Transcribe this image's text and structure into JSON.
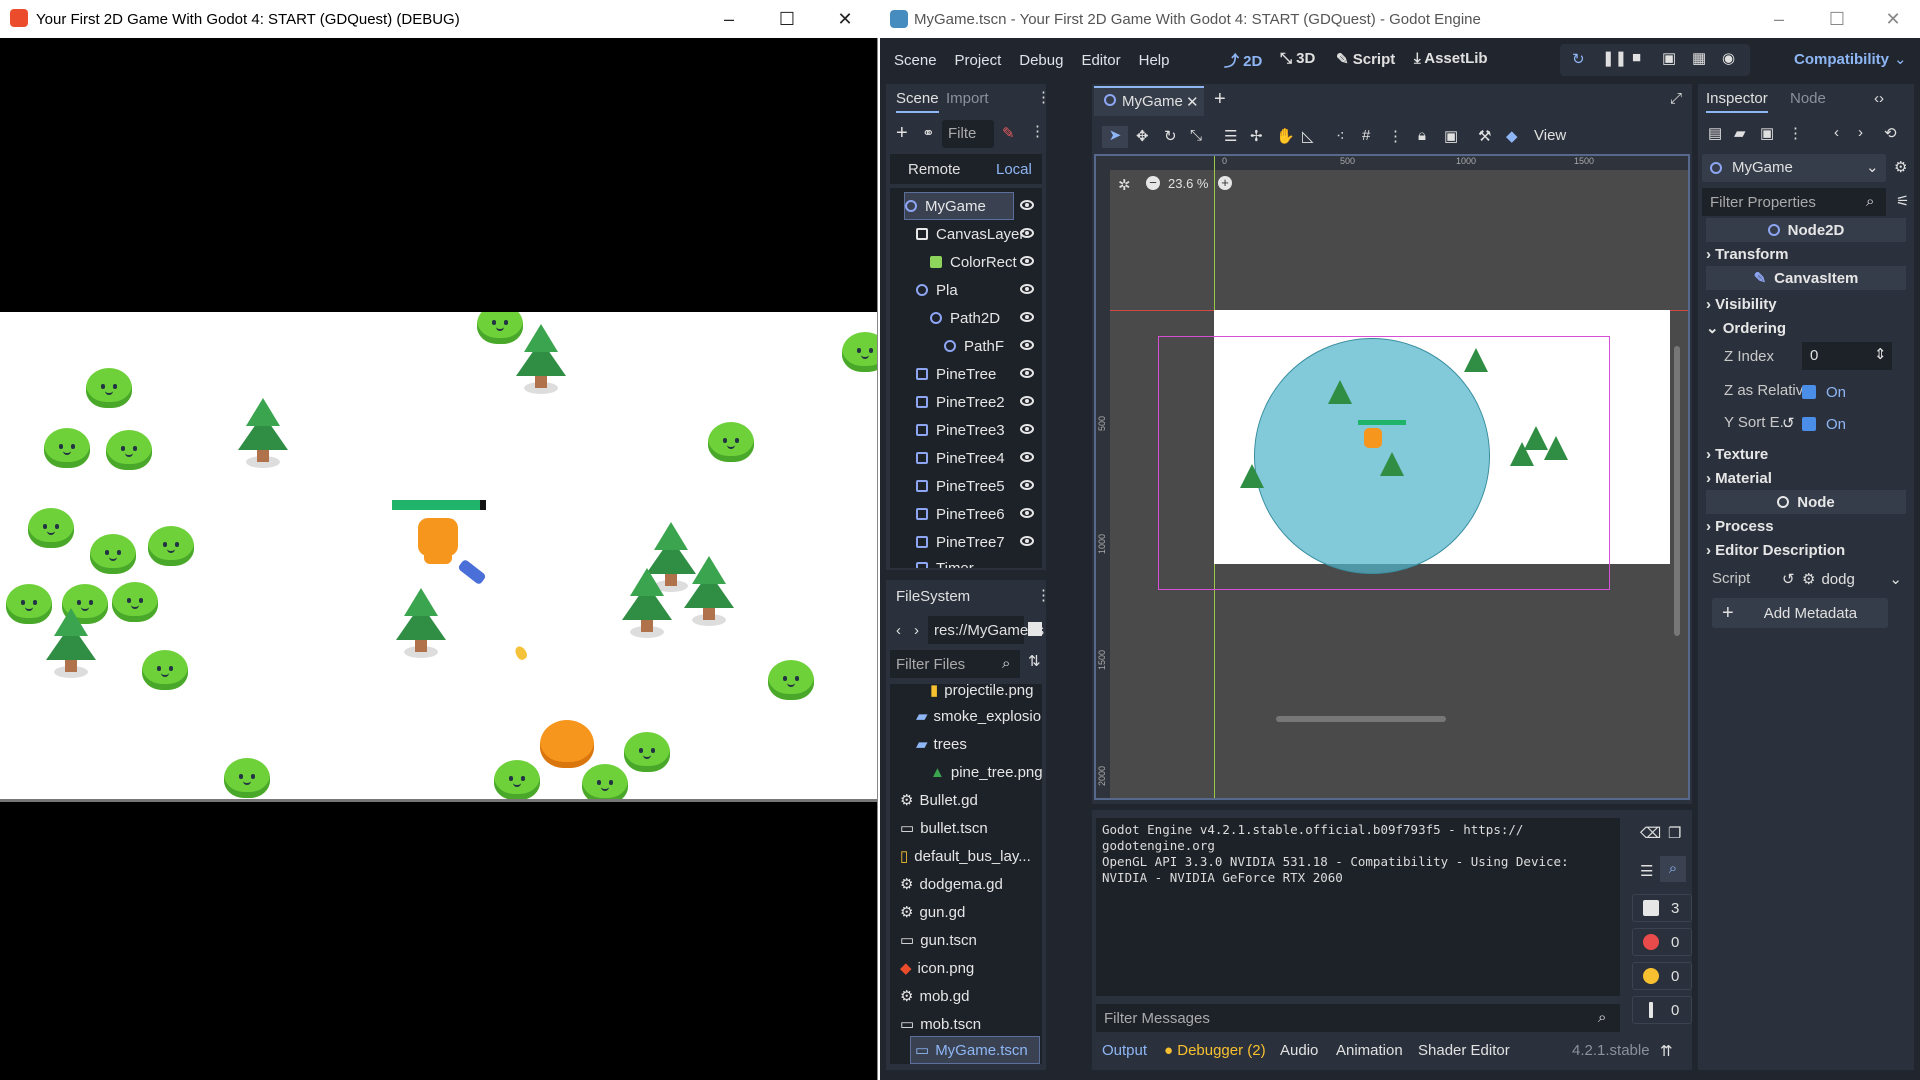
{
  "game_window": {
    "title": "Your First 2D Game With Godot 4: START (GDQuest) (DEBUG)",
    "controls": [
      "–",
      "☐",
      "✕"
    ]
  },
  "editor_window": {
    "title": "MyGame.tscn - Your First 2D Game With Godot 4: START (GDQuest) - Godot Engine",
    "controls": [
      "–",
      "☐",
      "✕"
    ]
  },
  "menubar": {
    "items": [
      "Scene",
      "Project",
      "Debug",
      "Editor",
      "Help"
    ],
    "workspaces": [
      "2D",
      "3D",
      "Script",
      "AssetLib"
    ],
    "renderer": "Compatibility"
  },
  "scene_dock": {
    "tabs": [
      "Scene",
      "Import"
    ],
    "filter_placeholder": "Filte",
    "remote_label": "Remote",
    "local_label": "Local",
    "nodes": [
      {
        "label": "MyGame",
        "depth": 0,
        "selected": true
      },
      {
        "label": "CanvasLayer",
        "depth": 1
      },
      {
        "label": "ColorRect",
        "depth": 2
      },
      {
        "label": "Pla",
        "depth": 1
      },
      {
        "label": "Path2D",
        "depth": 2
      },
      {
        "label": "PathF",
        "depth": 3
      },
      {
        "label": "PineTree",
        "depth": 1
      },
      {
        "label": "PineTree2",
        "depth": 1
      },
      {
        "label": "PineTree3",
        "depth": 1
      },
      {
        "label": "PineTree4",
        "depth": 1
      },
      {
        "label": "PineTree5",
        "depth": 1
      },
      {
        "label": "PineTree6",
        "depth": 1
      },
      {
        "label": "PineTree7",
        "depth": 1
      },
      {
        "label": "Timer",
        "depth": 1
      }
    ]
  },
  "filesystem_dock": {
    "title": "FileSystem",
    "path": "res://MyGame.ts",
    "filter_placeholder": "Filter Files",
    "files": [
      {
        "label": "projectile.png",
        "depth": 2
      },
      {
        "label": "smoke_explosion",
        "depth": 1
      },
      {
        "label": "trees",
        "depth": 1
      },
      {
        "label": "pine_tree.png",
        "depth": 2
      },
      {
        "label": "Bullet.gd",
        "depth": 1
      },
      {
        "label": "bullet.tscn",
        "depth": 1
      },
      {
        "label": "default_bus_lay...",
        "depth": 1
      },
      {
        "label": "dodgema.gd",
        "depth": 1
      },
      {
        "label": "gun.gd",
        "depth": 1
      },
      {
        "label": "gun.tscn",
        "depth": 1
      },
      {
        "label": "icon.png",
        "depth": 1
      },
      {
        "label": "mob.gd",
        "depth": 1
      },
      {
        "label": "mob.tscn",
        "depth": 1
      },
      {
        "label": "MyGame.tscn",
        "depth": 1,
        "selected": true
      }
    ]
  },
  "viewport": {
    "tab_label": "MyGame",
    "zoom": "23.6 %",
    "view_label": "View",
    "ruler_marks_top": [
      "0",
      "500",
      "1000",
      "1500"
    ],
    "ruler_marks_left": [
      "500",
      "1000",
      "1500",
      "2000"
    ]
  },
  "output": {
    "lines": [
      "Godot Engine v4.2.1.stable.official.b09f793f5 - https://",
      "godotengine.org",
      "OpenGL API 3.3.0 NVIDIA 531.18 - Compatibility - Using Device:",
      "NVIDIA - NVIDIA GeForce RTX 2060"
    ],
    "filter_placeholder": "Filter Messages",
    "counts": {
      "messages": "3",
      "errors": "0",
      "warnings": "0",
      "info": "0"
    }
  },
  "bottom_tabs": [
    "Output",
    "Debugger (2)",
    "Audio",
    "Animation",
    "Shader Editor"
  ],
  "version": "4.2.1.stable",
  "inspector": {
    "tabs": [
      "Inspector",
      "Node"
    ],
    "node_name": "MyGame",
    "filter_placeholder": "Filter Properties",
    "class_header": "Node2D",
    "transform": "Transform",
    "canvasitem_header": "CanvasItem",
    "visibility": "Visibility",
    "ordering": "Ordering",
    "z_index_label": "Z Index",
    "z_index_value": "0",
    "z_relative_label": "Z as Relative",
    "z_relative_value": "On",
    "ysort_label": "Y Sort E...",
    "ysort_value": "On",
    "texture": "Texture",
    "material": "Material",
    "node_header": "Node",
    "process": "Process",
    "editor_description": "Editor Description",
    "script_label": "Script",
    "script_value": "dodg",
    "add_metadata": "Add Metadata"
  },
  "colors": {
    "editor_bg": "#21262e",
    "panel_bg": "#2b313c",
    "accent": "#4a8ee8",
    "slime": "#6fd13a",
    "tree": "#2f8d44"
  }
}
